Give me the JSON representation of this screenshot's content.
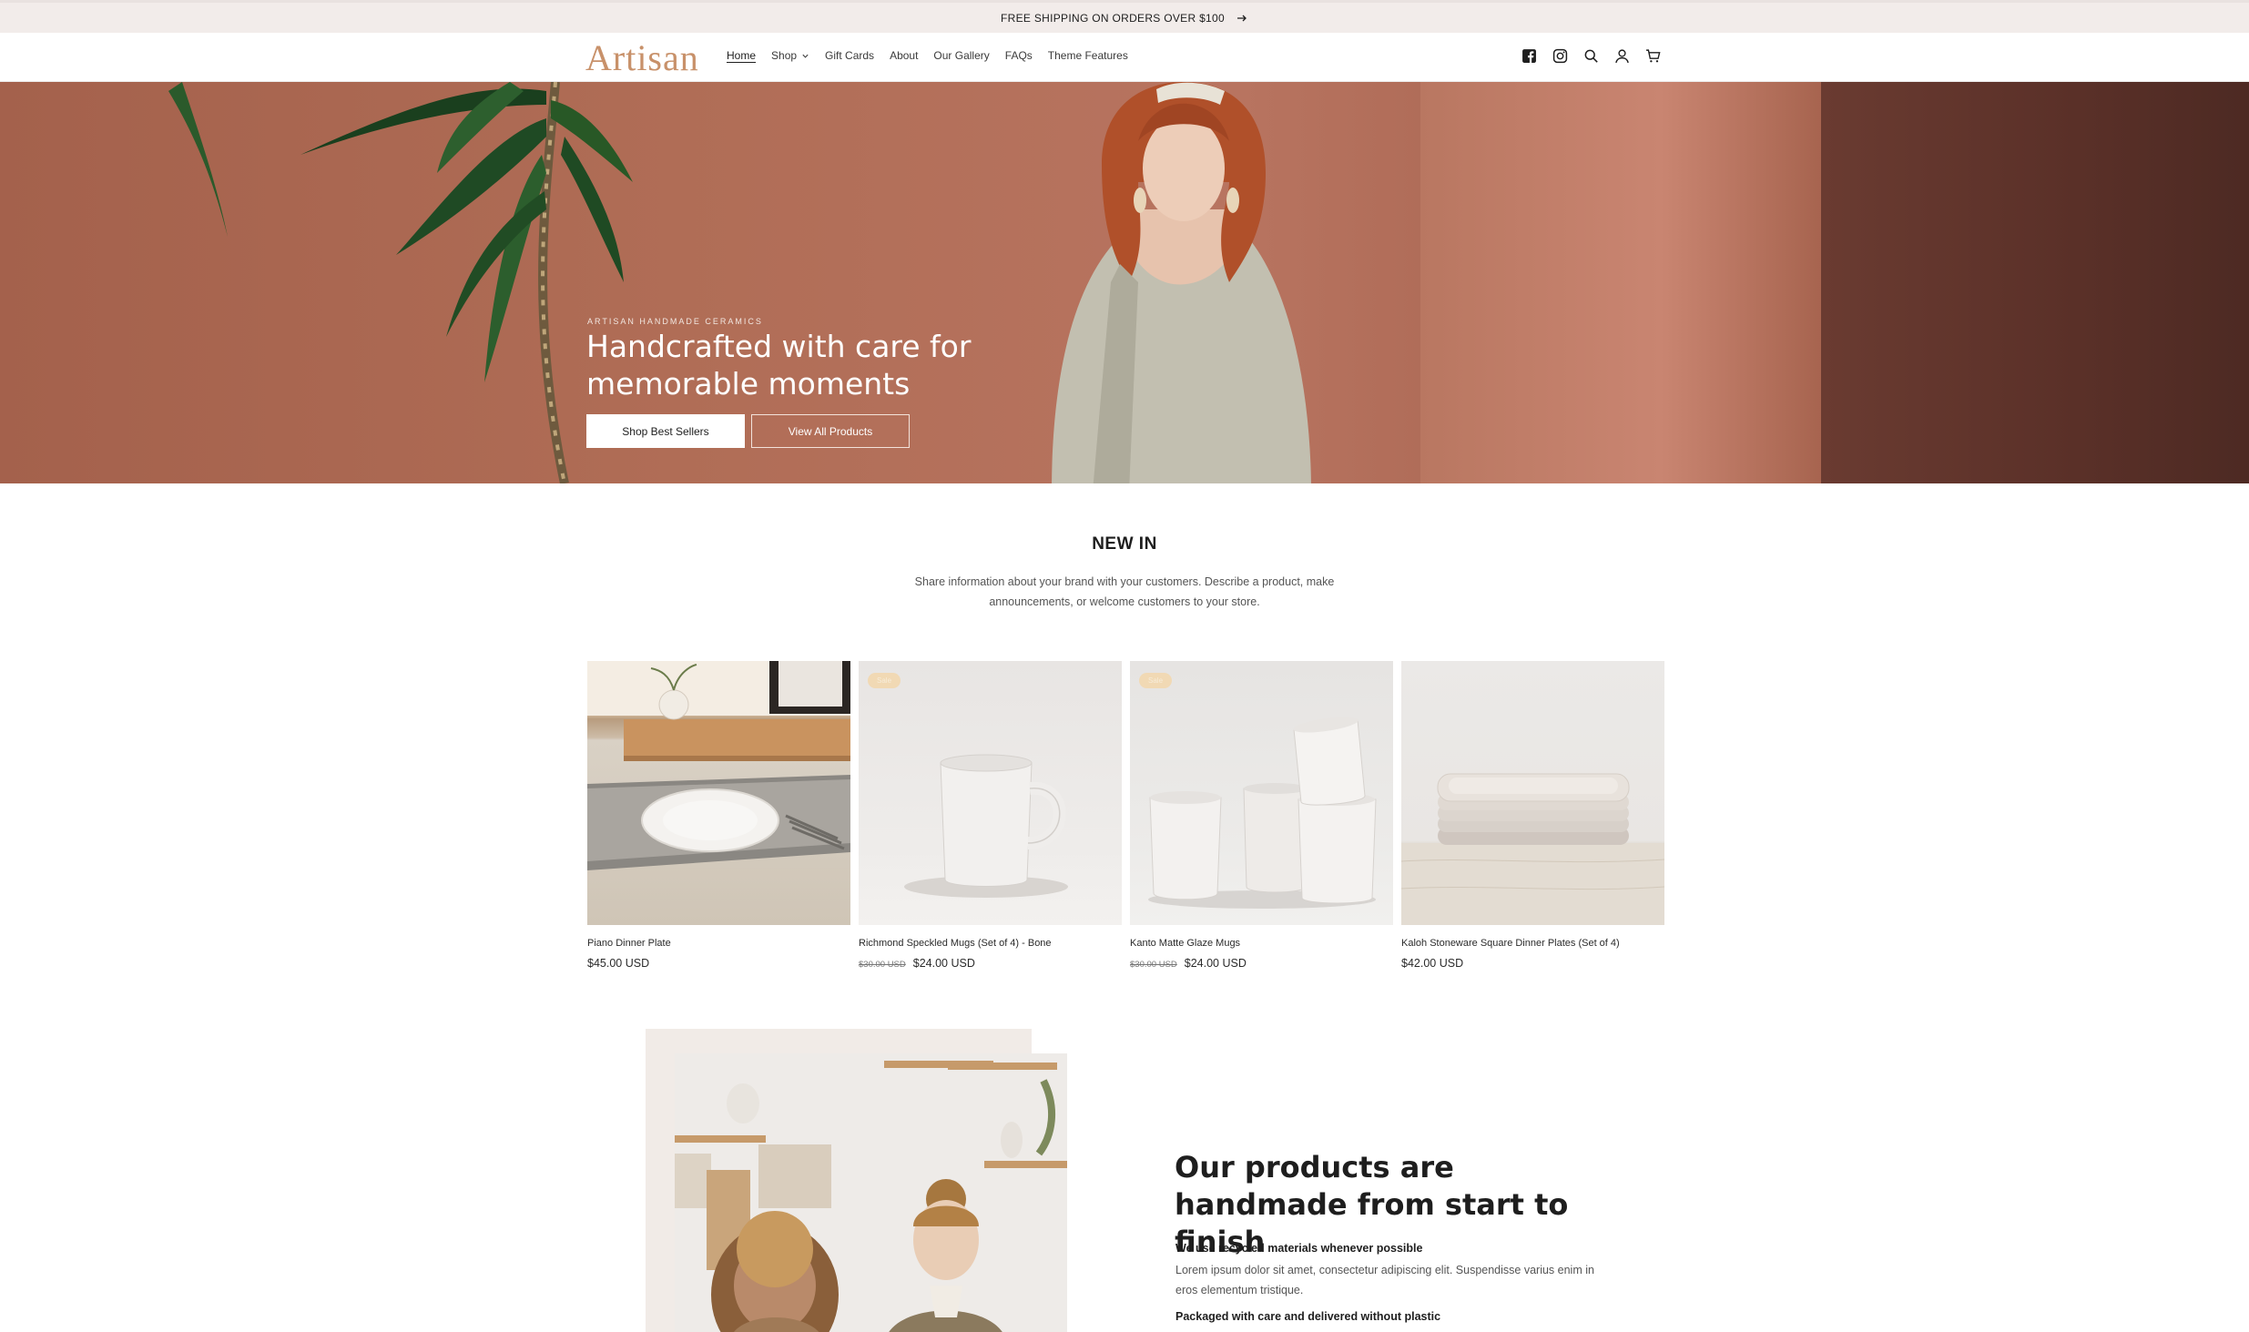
{
  "announcement": {
    "text": "FREE SHIPPING ON ORDERS OVER $100",
    "icon": "arrow-right-icon"
  },
  "header": {
    "logo": "Artisan",
    "nav": [
      {
        "label": "Home",
        "active": true
      },
      {
        "label": "Shop",
        "has_dropdown": true
      },
      {
        "label": "Gift Cards"
      },
      {
        "label": "About"
      },
      {
        "label": "Our Gallery"
      },
      {
        "label": "FAQs"
      },
      {
        "label": "Theme Features"
      }
    ],
    "icons": [
      "facebook-icon",
      "instagram-icon",
      "search-icon",
      "account-icon",
      "cart-icon"
    ]
  },
  "hero": {
    "eyebrow": "ARTISAN HANDMADE CERAMICS",
    "title": "Handcrafted with care for memorable moments",
    "primary_button": "Shop Best Sellers",
    "secondary_button": "View All Products"
  },
  "new_in": {
    "title": "NEW IN",
    "description": "Share information about your brand with your customers. Describe a product, make announcements, or welcome customers to your store.",
    "products": [
      {
        "name": "Piano Dinner Plate",
        "price": "$45.00 USD",
        "old_price": "",
        "badge": ""
      },
      {
        "name": "Richmond Speckled Mugs (Set of 4) - Bone",
        "price": "$24.00 USD",
        "old_price": "$30.00 USD",
        "badge": "Sale"
      },
      {
        "name": "Kanto Matte Glaze Mugs",
        "price": "$24.00 USD",
        "old_price": "$30.00 USD",
        "badge": "Sale"
      },
      {
        "name": "Kaloh Stoneware Square Dinner Plates (Set of 4)",
        "price": "$42.00 USD",
        "old_price": "",
        "badge": ""
      }
    ]
  },
  "story": {
    "title": "Our products are handmade from start to finish",
    "sub1": "We use recycled materials whenever possible",
    "body": "Lorem ipsum dolor sit amet, consectetur adipiscing elit. Suspendisse varius enim in eros elementum tristique.",
    "sub2": "Packaged with care and delivered without plastic"
  },
  "colors": {
    "accent": "#c8916a",
    "hero_bg": "#b06d56",
    "announcement_bg": "#f2ecea"
  }
}
